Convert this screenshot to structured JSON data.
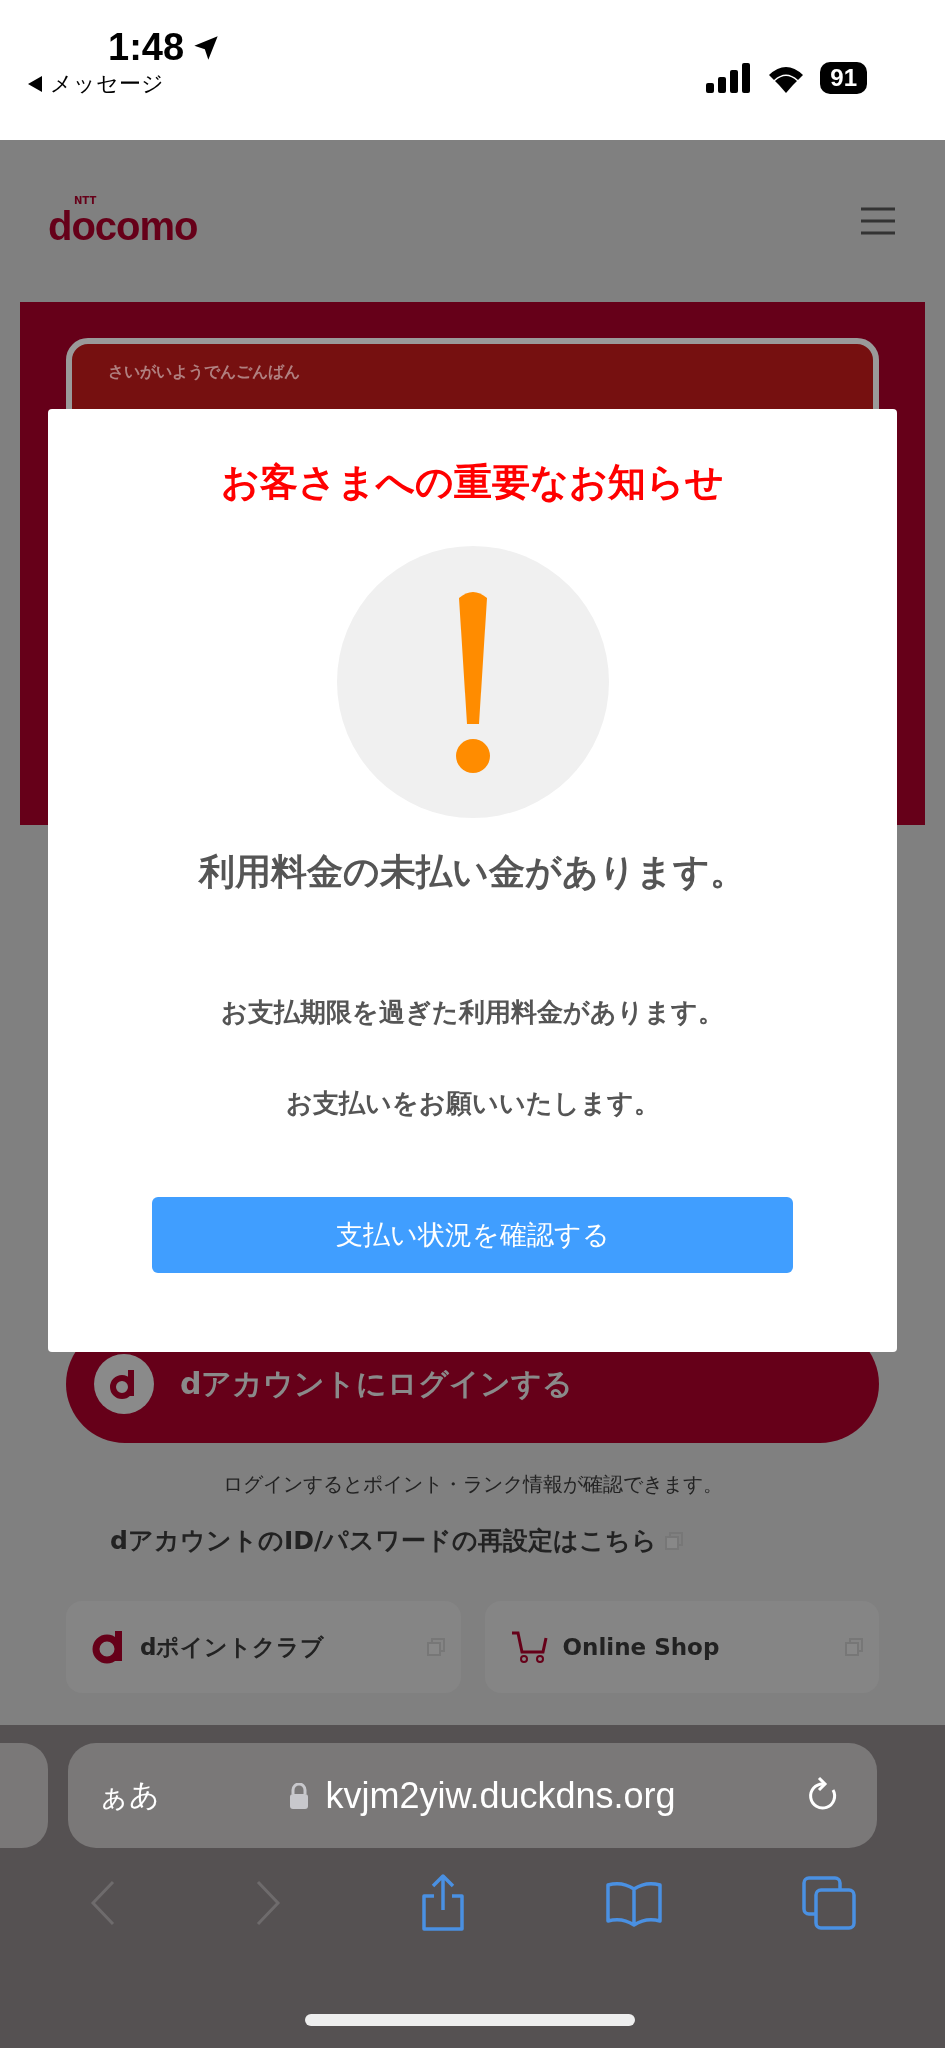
{
  "status_bar": {
    "time": "1:48",
    "back_label": "メッセージ",
    "battery": "91"
  },
  "page": {
    "logo_small": "NTT",
    "logo": "docomo",
    "banner": {
      "kana": "さいがいようでんごんばん"
    },
    "login_button": "dアカウントにログインする",
    "login_note": "ログインするとポイント・ランク情報が確認できます。",
    "reset_link": "dアカウントのID/パスワードの再設定はこちら",
    "cards": [
      {
        "kind": "dpoint",
        "label": "dポイントクラブ"
      },
      {
        "kind": "shop",
        "label": "Online Shop"
      }
    ]
  },
  "modal": {
    "title": "お客さまへの重要なお知らせ",
    "heading": "利用料金の未払い金があります。",
    "lines": [
      "お支払期限を過ぎた利用料金があります。",
      "お支払いをお願いいたします。"
    ],
    "button": "支払い状況を確認する"
  },
  "browser": {
    "text_size": "ぁあ",
    "url": "kvjm2yiw.duckdns.org"
  }
}
